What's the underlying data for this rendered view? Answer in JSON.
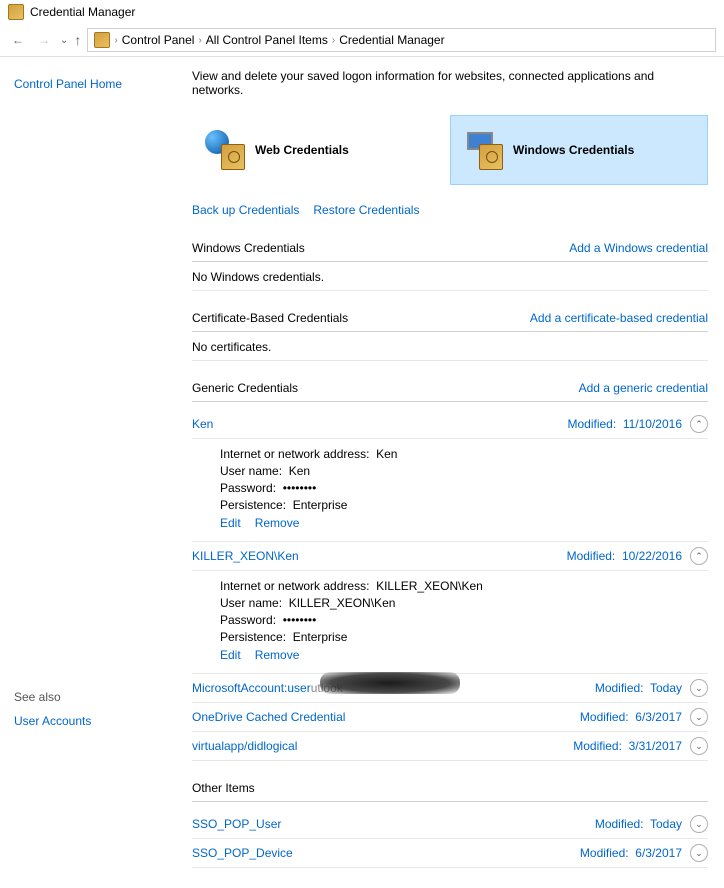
{
  "titlebar": {
    "title": "Credential Manager"
  },
  "breadcrumb": {
    "items": [
      "Control Panel",
      "All Control Panel Items",
      "Credential Manager"
    ]
  },
  "sidebar": {
    "home": "Control Panel Home",
    "see_also": "See also",
    "user_accounts": "User Accounts"
  },
  "intro": "View and delete your saved logon information for websites, connected applications and networks.",
  "tiles": {
    "web": "Web Credentials",
    "windows": "Windows Credentials"
  },
  "actions": {
    "backup": "Back up Credentials",
    "restore": "Restore Credentials"
  },
  "labels": {
    "modified": "Modified:",
    "addr": "Internet or network address:",
    "user": "User name:",
    "pass": "Password:",
    "persist": "Persistence:",
    "edit": "Edit",
    "remove": "Remove"
  },
  "sections": {
    "windows": {
      "title": "Windows Credentials",
      "add": "Add a Windows credential",
      "empty": "No Windows credentials."
    },
    "cert": {
      "title": "Certificate-Based Credentials",
      "add": "Add a certificate-based credential",
      "empty": "No certificates."
    },
    "generic": {
      "title": "Generic Credentials",
      "add": "Add a generic credential"
    },
    "other": {
      "title": "Other Items"
    }
  },
  "generic": [
    {
      "name": "Ken",
      "modified": "11/10/2016",
      "expanded": true,
      "addr": "Ken",
      "user": "Ken",
      "pass": "••••••••",
      "persist": "Enterprise"
    },
    {
      "name": "KILLER_XEON\\Ken",
      "modified": "10/22/2016",
      "expanded": true,
      "addr": "KILLER_XEON\\Ken",
      "user": "KILLER_XEON\\Ken",
      "pass": "••••••••",
      "persist": "Enterprise"
    },
    {
      "name": "MicrosoftAccount:user",
      "suffix": "utlook",
      "modified": "Today",
      "expanded": false,
      "redacted": true
    },
    {
      "name": "OneDrive Cached Credential",
      "modified": "6/3/2017",
      "expanded": false
    },
    {
      "name": "virtualapp/didlogical",
      "modified": "3/31/2017",
      "expanded": false
    }
  ],
  "other": [
    {
      "name": "SSO_POP_User",
      "modified": "Today"
    },
    {
      "name": "SSO_POP_Device",
      "modified": "6/3/2017"
    }
  ]
}
